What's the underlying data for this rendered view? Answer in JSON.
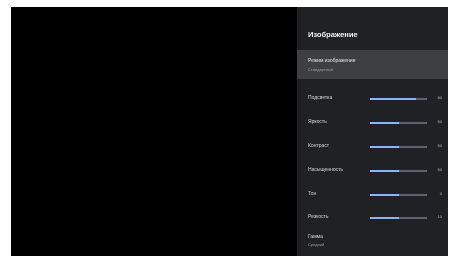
{
  "panel": {
    "title": "Изображение"
  },
  "mode": {
    "label": "Режим изображения",
    "value": "Стандартный"
  },
  "sliders": [
    {
      "label": "Подсветка",
      "value": "80",
      "level": 0.8
    },
    {
      "label": "Яркость",
      "value": "50",
      "level": 0.5
    },
    {
      "label": "Контраст",
      "value": "50",
      "level": 0.5
    },
    {
      "label": "Насыщенность",
      "value": "50",
      "level": 0.5
    },
    {
      "label": "Тон",
      "value": "0",
      "level": 0.5
    },
    {
      "label": "Резкость",
      "value": "10",
      "level": 0.5
    }
  ],
  "gamma": {
    "label": "Гамма",
    "value": "Средний"
  },
  "colors": {
    "screen": "#030303",
    "panel": "#202124",
    "selected": "#3c4043",
    "accent": "#8ab4f8",
    "track": "#5f6368"
  }
}
